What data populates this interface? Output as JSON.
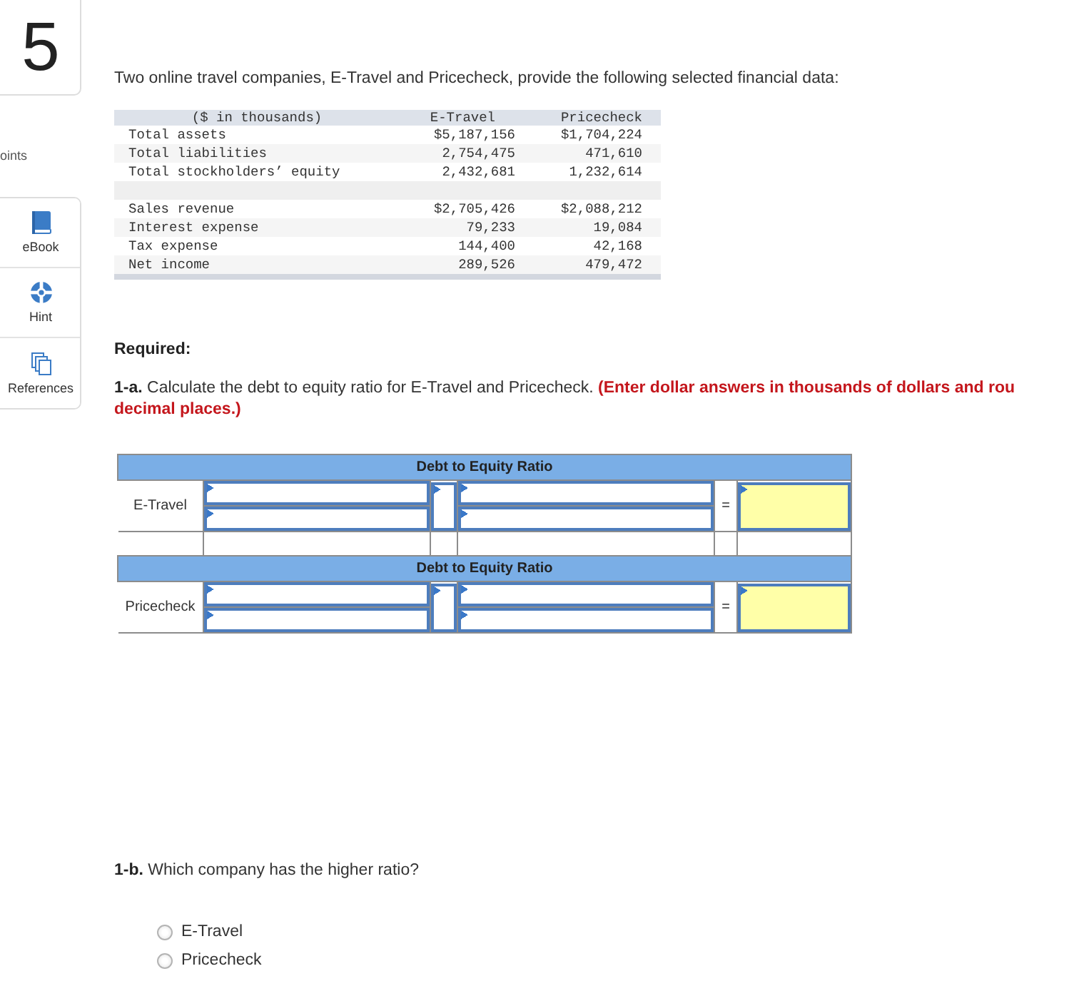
{
  "sidebar": {
    "question_number": "5",
    "points_label": "oints",
    "tools": [
      {
        "kind": "ebook",
        "label": "eBook"
      },
      {
        "kind": "hint",
        "label": "Hint"
      },
      {
        "kind": "references",
        "label": "References"
      }
    ]
  },
  "intro": "Two online travel companies, E-Travel and Pricecheck, provide the following selected financial data:",
  "financial_table": {
    "columns": [
      "($ in thousands)",
      "E-Travel",
      "Pricecheck"
    ],
    "sections": [
      {
        "rows": [
          {
            "label": "Total assets",
            "values": [
              "$5,187,156",
              "$1,704,224"
            ]
          },
          {
            "label": "Total liabilities",
            "values": [
              "2,754,475",
              "471,610"
            ]
          },
          {
            "label": "Total stockholders’ equity",
            "values": [
              "2,432,681",
              "1,232,614"
            ]
          }
        ]
      },
      {
        "rows": [
          {
            "label": "Sales revenue",
            "values": [
              "$2,705,426",
              "$2,088,212"
            ]
          },
          {
            "label": "Interest expense",
            "values": [
              "79,233",
              "19,084"
            ]
          },
          {
            "label": "Tax expense",
            "values": [
              "144,400",
              "42,168"
            ]
          },
          {
            "label": "Net income",
            "values": [
              "289,526",
              "479,472"
            ]
          }
        ]
      }
    ]
  },
  "required_label": "Required:",
  "part_a": {
    "prompt": "**1-a.** Calculate the debt to equity ratio for E-Travel and Pricecheck.",
    "instruction_lines": [
      "(Enter dollar answers in thousands of dollars and rou",
      "decimal places.)"
    ]
  },
  "ratio_tables": [
    {
      "header": "Debt to Equity Ratio",
      "company": "E-Travel",
      "equals": "="
    },
    {
      "header": "Debt to Equity Ratio",
      "company": "Pricecheck",
      "equals": "="
    }
  ],
  "part_b": {
    "prompt": "**1-b.** Which company has the higher ratio?",
    "options": [
      {
        "label": "E-Travel",
        "selected": false
      },
      {
        "label": "Pricecheck",
        "selected": false
      }
    ]
  }
}
